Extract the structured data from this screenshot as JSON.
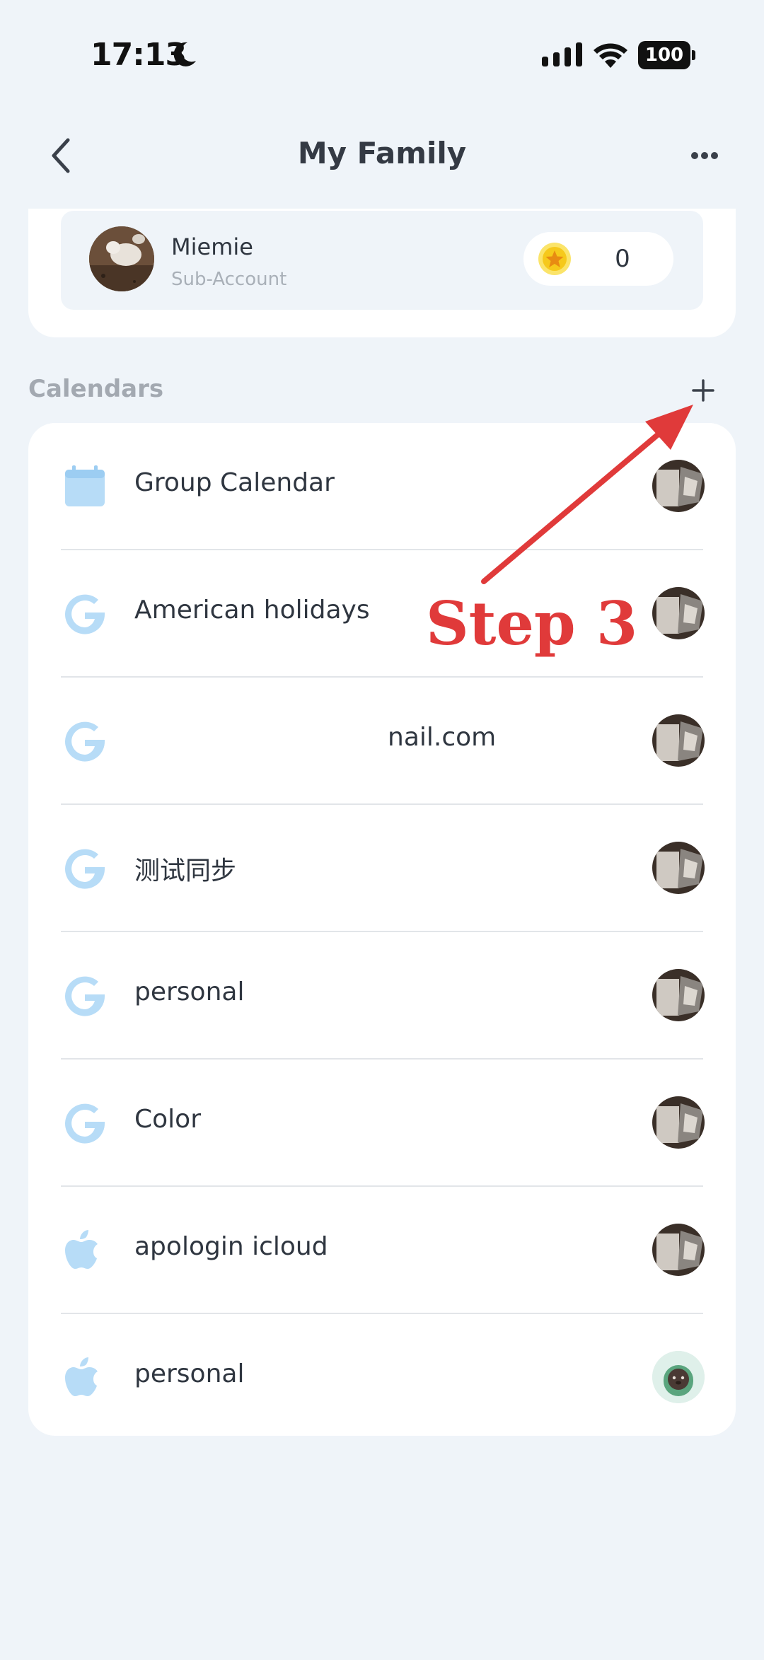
{
  "status_bar": {
    "time": "17:13",
    "battery": "100",
    "icons": [
      "moon-icon",
      "signal-icon",
      "wifi-icon",
      "battery-icon"
    ]
  },
  "header": {
    "title": "My Family",
    "back_icon": "chevron-left-icon",
    "more_icon": "more-horizontal-icon"
  },
  "member": {
    "name": "Miemie",
    "role": "Sub-Account",
    "points": "0"
  },
  "calendars": {
    "title": "Calendars",
    "add_label": "+",
    "items": [
      {
        "icon": "calendar-icon",
        "label": "Group Calendar"
      },
      {
        "icon": "google-icon",
        "label": "American holidays"
      },
      {
        "icon": "google-icon",
        "label": "nail.com"
      },
      {
        "icon": "google-icon",
        "label": "测试同步"
      },
      {
        "icon": "google-icon",
        "label": "personal"
      },
      {
        "icon": "google-icon",
        "label": "Color"
      },
      {
        "icon": "apple-icon",
        "label": "apologin icloud"
      },
      {
        "icon": "apple-icon",
        "label": "personal"
      }
    ]
  },
  "annotation": {
    "text": "Step 3",
    "color": "#e03a3a"
  },
  "colors": {
    "background": "#eff4f9",
    "icon_blue": "#b7dcf7",
    "accent_red": "#e03a3a"
  }
}
